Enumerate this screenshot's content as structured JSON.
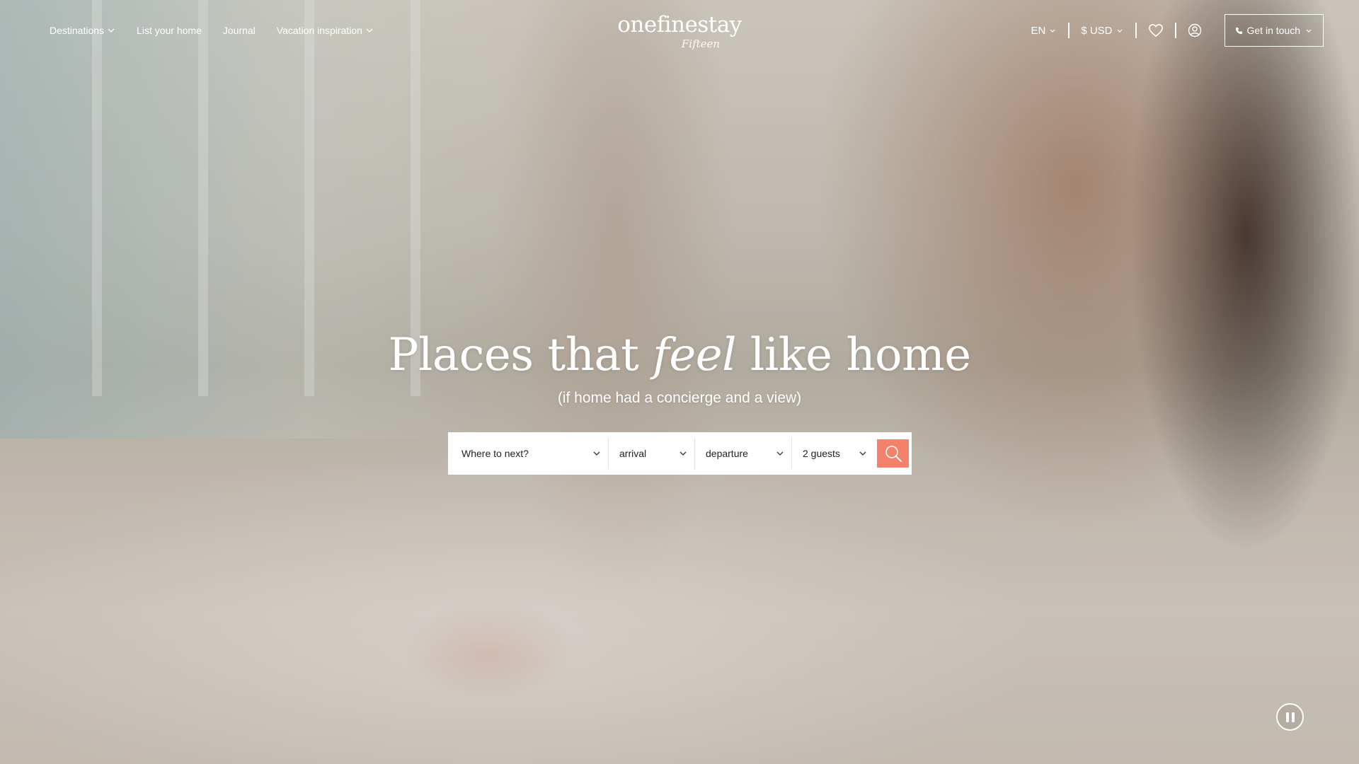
{
  "header": {
    "nav_left": [
      {
        "label": "Destinations",
        "has_dropdown": true
      },
      {
        "label": "List your home",
        "has_dropdown": false
      },
      {
        "label": "Journal",
        "has_dropdown": false
      },
      {
        "label": "Vacation inspiration",
        "has_dropdown": true
      }
    ],
    "logo": {
      "main": "onefinestay",
      "sub": "Fifteen"
    },
    "language": "EN",
    "currency": "$ USD",
    "wishlist_icon": "heart-icon",
    "account_icon": "user-icon",
    "contact_label": "Get in touch",
    "contact_icon": "phone-icon"
  },
  "hero": {
    "headline_before": "Places that ",
    "headline_emphasis": "feel",
    "headline_after": " like home",
    "subline": "(if home had a concierge and a view)"
  },
  "search": {
    "destination": "Where to next?",
    "arrival": "arrival",
    "departure": "departure",
    "guests": "2 guests",
    "search_icon": "search-icon",
    "button_color": "#f4826a"
  },
  "video": {
    "pause_icon": "pause-icon"
  }
}
